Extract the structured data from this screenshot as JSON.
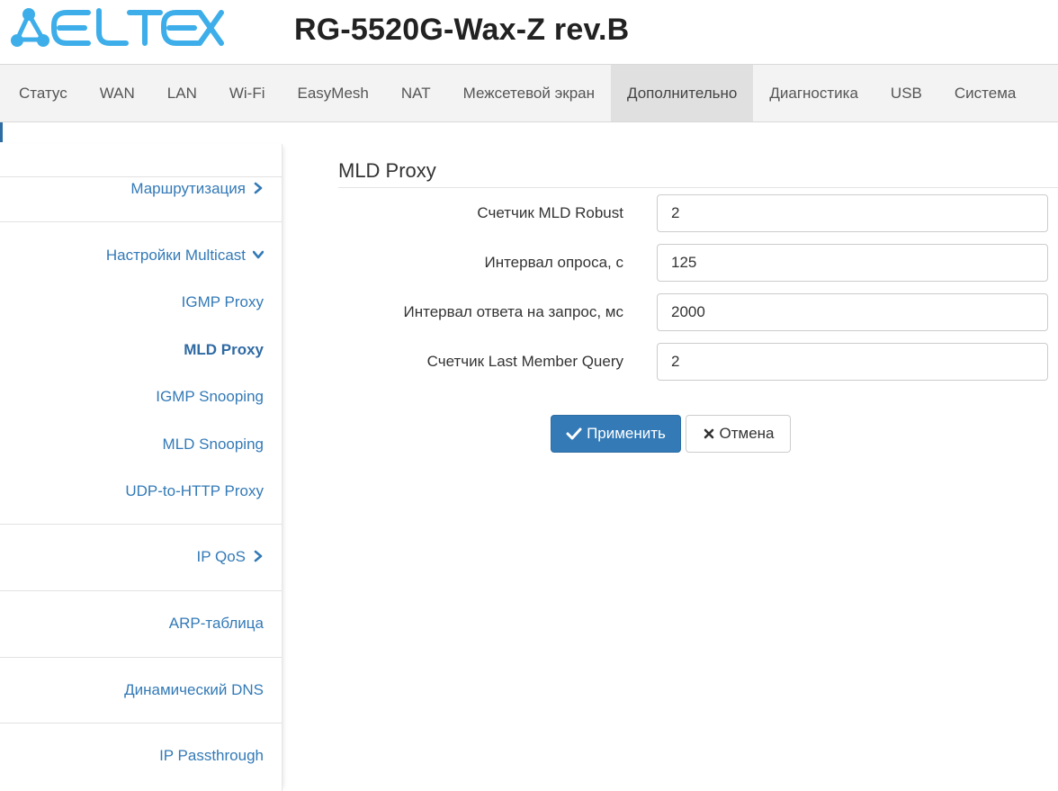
{
  "header": {
    "logo_text": "ELTEX",
    "device_title": "RG-5520G-Wax-Z rev.B"
  },
  "nav": {
    "items": [
      {
        "label": "Статус",
        "active": false
      },
      {
        "label": "WAN",
        "active": false
      },
      {
        "label": "LAN",
        "active": false
      },
      {
        "label": "Wi-Fi",
        "active": false
      },
      {
        "label": "EasyMesh",
        "active": false
      },
      {
        "label": "NAT",
        "active": false
      },
      {
        "label": "Межсетевой экран",
        "active": false
      },
      {
        "label": "Дополнительно",
        "active": true
      },
      {
        "label": "Диагностика",
        "active": false
      },
      {
        "label": "USB",
        "active": false
      },
      {
        "label": "Система",
        "active": false
      }
    ]
  },
  "sidebar": {
    "routing": {
      "label": "Маршрутизация",
      "icon": "chevron-right-icon"
    },
    "multicast": {
      "label": "Настройки Multicast",
      "icon": "chevron-down-icon",
      "children": [
        {
          "label": "IGMP Proxy",
          "active": false
        },
        {
          "label": "MLD Proxy",
          "active": true
        },
        {
          "label": "IGMP Snooping",
          "active": false
        },
        {
          "label": "MLD Snooping",
          "active": false
        },
        {
          "label": "UDP-to-HTTP Proxy",
          "active": false
        }
      ]
    },
    "ipqos": {
      "label": "IP QoS",
      "icon": "chevron-right-icon"
    },
    "arp": {
      "label": "ARP-таблица"
    },
    "ddns": {
      "label": "Динамический DNS"
    },
    "passthrough": {
      "label": "IP Passthrough"
    }
  },
  "main": {
    "title": "MLD Proxy",
    "fields": [
      {
        "label": "Счетчик MLD Robust",
        "value": "2"
      },
      {
        "label": "Интервал опроса, с",
        "value": "125"
      },
      {
        "label": "Интервал ответа на запрос, мс",
        "value": "2000"
      },
      {
        "label": "Счетчик Last Member Query",
        "value": "2"
      }
    ],
    "apply_label": "Применить",
    "cancel_label": "Отмена"
  },
  "colors": {
    "brand": "#3daee9",
    "link": "#337ab7",
    "primary": "#337ab7"
  }
}
